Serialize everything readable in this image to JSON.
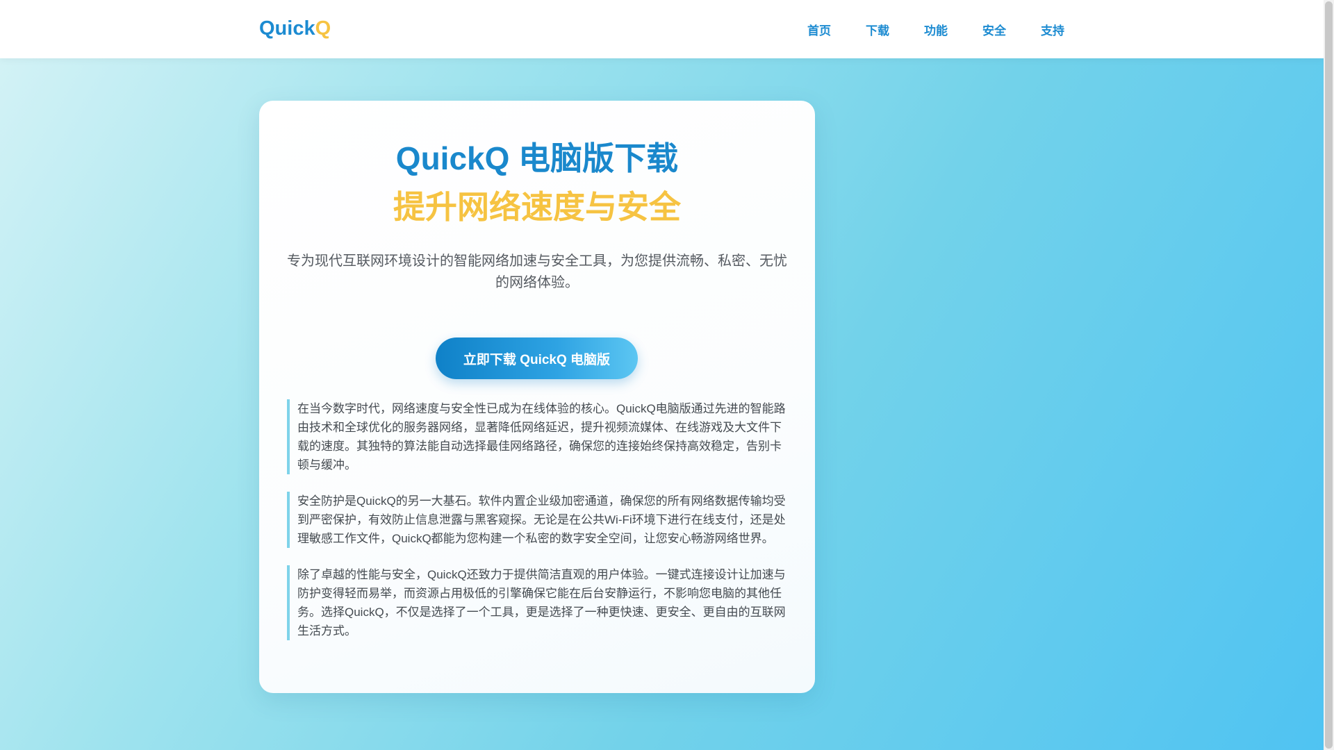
{
  "header": {
    "logo_main": "Quick",
    "logo_accent": "Q",
    "nav": [
      "首页",
      "下载",
      "功能",
      "安全",
      "支持"
    ]
  },
  "hero": {
    "title": "QuickQ 电脑版下载",
    "subtitle": "提升网络速度与安全",
    "description": "专为现代互联网环境设计的智能网络加速与安全工具，为您提供流畅、私密、无忧的网络体验。",
    "download_button": "立即下载 QuickQ 电脑版"
  },
  "paragraphs": [
    "在当今数字时代，网络速度与安全性已成为在线体验的核心。QuickQ电脑版通过先进的智能路由技术和全球优化的服务器网络，显著降低网络延迟，提升视频流媒体、在线游戏及大文件下载的速度。其独特的算法能自动选择最佳网络路径，确保您的连接始终保持高效稳定，告别卡顿与缓冲。",
    "安全防护是QuickQ的另一大基石。软件内置企业级加密通道，确保您的所有网络数据传输均受到严密保护，有效防止信息泄露与黑客窥探。无论是在公共Wi-Fi环境下进行在线支付，还是处理敏感工作文件，QuickQ都能为您构建一个私密的数字安全空间，让您安心畅游网络世界。",
    "除了卓越的性能与安全，QuickQ还致力于提供简洁直观的用户体验。一键式连接设计让加速与防护变得轻而易举，而资源占用极低的引擎确保它能在后台安静运行，不影响您电脑的其他任务。选择QuickQ，不仅是选择了一个工具，更是选择了一种更快速、更安全、更自由的互联网生活方式。"
  ],
  "colors": {
    "brand_blue": "#1c8bd1",
    "brand_yellow": "#f6c342",
    "accent_border": "#7ed3ea"
  }
}
